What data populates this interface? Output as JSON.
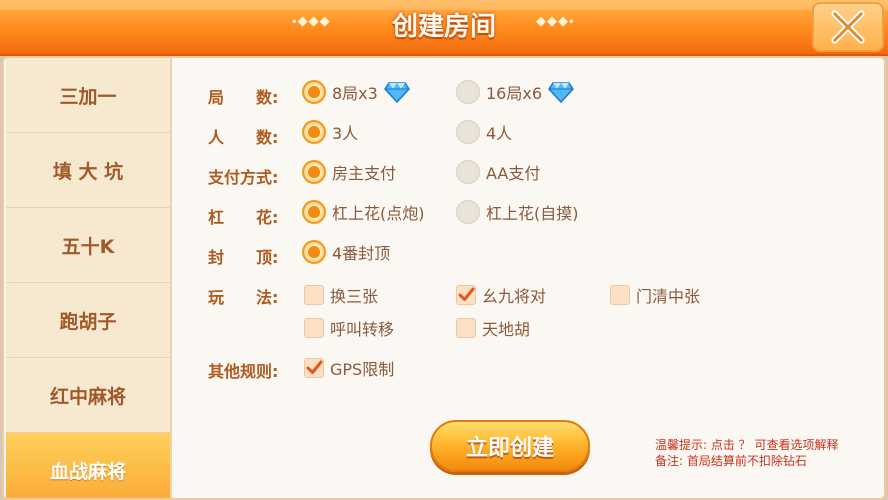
{
  "header": {
    "title": "创建房间",
    "deco_left": "⬩◆◆◆",
    "deco_right": "◆◆◆⬩"
  },
  "sidebar": {
    "items": [
      {
        "label": "三加一"
      },
      {
        "label": "填 大 坑"
      },
      {
        "label": "五十K"
      },
      {
        "label": "跑胡子"
      },
      {
        "label": "红中麻将"
      },
      {
        "label": "血战麻将",
        "active": true
      }
    ]
  },
  "rules": {
    "rounds": {
      "label": "局　　数:",
      "options": [
        "8局x3",
        "16局x6"
      ],
      "selected": 0
    },
    "players": {
      "label": "人　　数:",
      "options": [
        "3人",
        "4人"
      ],
      "selected": 0
    },
    "payment": {
      "label": "支付方式:",
      "options": [
        "房主支付",
        "AA支付"
      ],
      "selected": 0
    },
    "gang": {
      "label": "杠　　花:",
      "options": [
        "杠上花(点炮)",
        "杠上花(自摸)"
      ],
      "selected": 0
    },
    "cap": {
      "label": "封　　顶:",
      "options": [
        "4番封顶"
      ],
      "selected": 0
    },
    "play": {
      "label": "玩　　法:",
      "options": [
        {
          "text": "换三张",
          "checked": false
        },
        {
          "text": "幺九将对",
          "checked": true
        },
        {
          "text": "门清中张",
          "checked": false
        },
        {
          "text": "呼叫转移",
          "checked": false
        },
        {
          "text": "天地胡",
          "checked": false
        }
      ]
    },
    "other": {
      "label": "其他规则:",
      "options": [
        {
          "text": "GPS限制",
          "checked": true
        }
      ]
    }
  },
  "footer": {
    "create_label": "立即创建",
    "tip_line1": "温馨提示: 点击 ？ 可查看选项解释",
    "tip_line2": "备注: 首局结算前不扣除钻石"
  },
  "colors": {
    "accent": "#ff8a1c",
    "label": "#b05a20",
    "tip": "#c8321c",
    "gem": "#3aa8f0"
  }
}
